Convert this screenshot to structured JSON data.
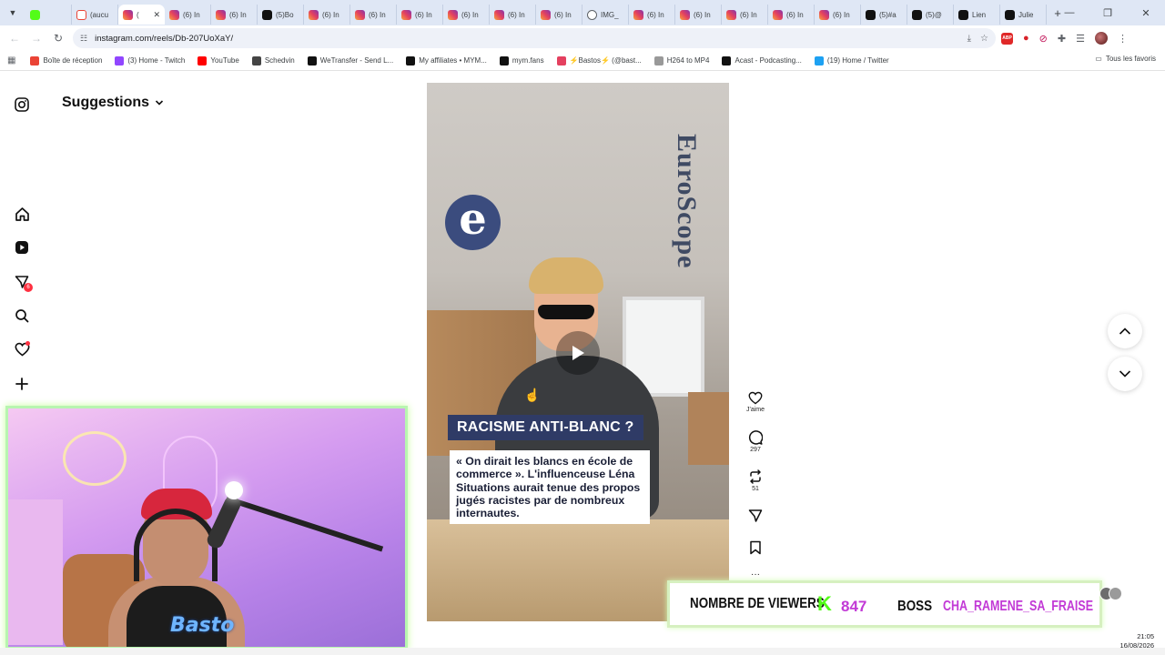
{
  "browser": {
    "tabs": [
      {
        "label": "",
        "fav": "kick"
      },
      {
        "label": "(aucu",
        "fav": "gmail"
      },
      {
        "label": "(",
        "fav": "ig",
        "active": true
      },
      {
        "label": "(6) In",
        "fav": "ig"
      },
      {
        "label": "(6) In",
        "fav": "ig"
      },
      {
        "label": "(5)Bo",
        "fav": "tiktok"
      },
      {
        "label": "(6) In",
        "fav": "ig"
      },
      {
        "label": "(6) In",
        "fav": "ig"
      },
      {
        "label": "(6) In",
        "fav": "ig"
      },
      {
        "label": "(6) In",
        "fav": "ig"
      },
      {
        "label": "(6) In",
        "fav": "ig"
      },
      {
        "label": "(6) In",
        "fav": "ig"
      },
      {
        "label": "IMG_",
        "fav": "globe"
      },
      {
        "label": "(6) In",
        "fav": "ig"
      },
      {
        "label": "(6) In",
        "fav": "ig"
      },
      {
        "label": "(6) In",
        "fav": "ig"
      },
      {
        "label": "(6) In",
        "fav": "ig"
      },
      {
        "label": "(6) In",
        "fav": "ig"
      },
      {
        "label": "(5)#a",
        "fav": "tiktok"
      },
      {
        "label": "(5)@",
        "fav": "tiktok"
      },
      {
        "label": "Lien",
        "fav": "we"
      },
      {
        "label": "Julie",
        "fav": "tiktok"
      }
    ],
    "new_tab": "+",
    "url": "instagram.com/reels/Db-207UoXaY/",
    "bookmarks": [
      {
        "label": "Boîte de réception",
        "color": "#ea4335"
      },
      {
        "label": "(3) Home - Twitch",
        "color": "#9146ff"
      },
      {
        "label": "YouTube",
        "color": "#ff0000"
      },
      {
        "label": "Schedvin",
        "color": "#444444"
      },
      {
        "label": "WeTransfer - Send L...",
        "color": "#111111"
      },
      {
        "label": "My affiliates • MYM...",
        "color": "#111111"
      },
      {
        "label": "mym.fans",
        "color": "#111111"
      },
      {
        "label": "⚡Bastos⚡ (@bast...",
        "color": "#e4405f"
      },
      {
        "label": "H264 to MP4",
        "color": "#999999"
      },
      {
        "label": "Acast - Podcasting...",
        "color": "#111111"
      },
      {
        "label": "(19) Home / Twitter",
        "color": "#1da1f2"
      }
    ],
    "all_bookmarks": "Tous les favoris"
  },
  "instagram": {
    "suggestions_label": "Suggestions",
    "notif_count": "6",
    "reel": {
      "brand_logo_letter": "e",
      "brand_name": "EuroScope",
      "headline": "RACISME ANTI-BLANC ?",
      "quote": "« On dirait les blancs en école de commerce ». L'influenceuse Léna Situations aurait tenue des propos jugés racistes par de nombreux internautes."
    },
    "actions": {
      "like_label": "J'aime",
      "comments_count": "297",
      "reposts_count": "51"
    }
  },
  "stream": {
    "webcam_logo": "Basto",
    "viewers_label": "NOMBRE DE VIEWERS",
    "viewers_count": "847",
    "boss_label": "BOSS",
    "boss_user": "CHA_RAMENE_SA_FRAISE"
  },
  "clock": {
    "time": "21:05",
    "date": "16/08/2026"
  }
}
